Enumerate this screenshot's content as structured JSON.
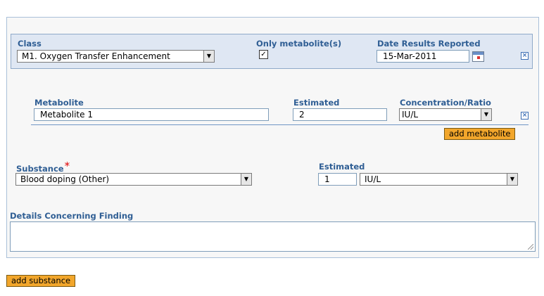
{
  "class_section": {
    "class_label": "Class",
    "class_value": "M1. Oxygen Transfer Enhancement",
    "only_metabolite_label": "Only metabolite(s)",
    "only_metabolite_checked": true,
    "checkbox_mark": "✓",
    "date_label": "Date Results Reported",
    "date_value": "15-Mar-2011",
    "remove_glyph": "×"
  },
  "metabolite": {
    "label": "Metabolite",
    "value": "Metabolite 1",
    "estimated_label": "Estimated",
    "estimated_value": "2",
    "concentration_label": "Concentration/Ratio",
    "concentration_value": "IU/L",
    "add_button": "add metabolite"
  },
  "substance": {
    "label": "Substance",
    "required_mark": "*",
    "value": "Blood doping (Other)",
    "estimated_label": "Estimated",
    "estimated_value": "1",
    "unit_value": "IU/L"
  },
  "details": {
    "label": "Details Concerning Finding",
    "value": ""
  },
  "add_substance_button": "add substance",
  "dropdown_glyph": "▼"
}
